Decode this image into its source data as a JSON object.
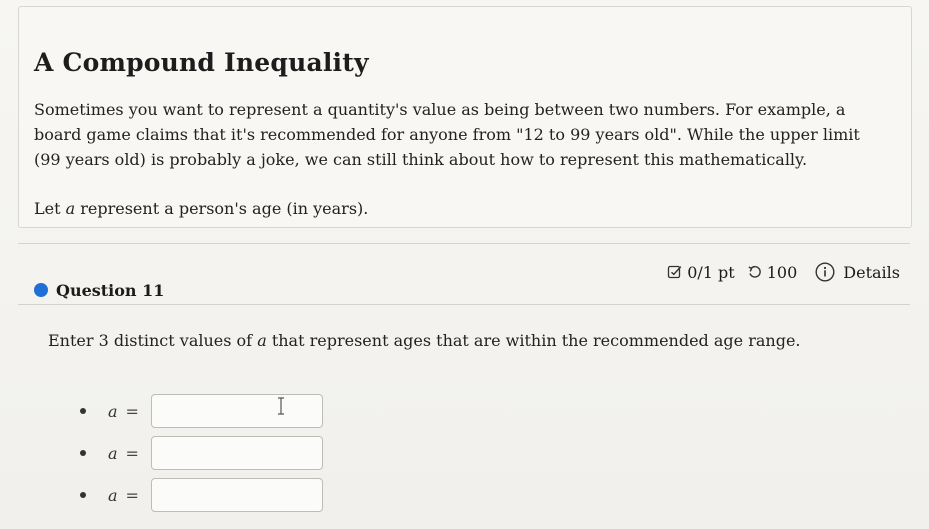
{
  "intro": {
    "title": "A Compound Inequality",
    "body": "Sometimes you want to represent a quantity's value as being between two numbers. For example, a board game claims that it's recommended for anyone from \"12 to 99 years old\". While the upper limit (99 years old) is probably a joke, we can still think about how to represent this mathematically.",
    "let_prefix": "Let ",
    "let_var": "a",
    "let_suffix": " represent a person's age (in years)."
  },
  "question": {
    "label": "Question 11",
    "score": "0/1 pt",
    "tries": "100",
    "details": "Details",
    "prompt_prefix": "Enter 3 distinct values of ",
    "prompt_var": "a",
    "prompt_suffix": " that represent ages that are within the recommended age range."
  },
  "answers": [
    {
      "lhs": "a",
      "eq": "=",
      "value": ""
    },
    {
      "lhs": "a",
      "eq": "=",
      "value": ""
    },
    {
      "lhs": "a",
      "eq": "=",
      "value": ""
    }
  ],
  "colors": {
    "accent": "#1f6fd6",
    "text": "#222222",
    "border": "#bdbdb8"
  },
  "icons": {
    "score": "checkbox-pencil-icon",
    "tries": "retry-icon",
    "details": "info-circle-icon"
  }
}
